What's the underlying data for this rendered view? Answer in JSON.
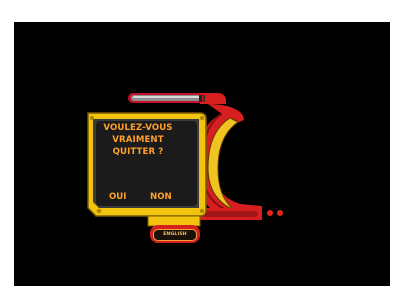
{
  "dialog": {
    "question_lines": [
      "VOULEZ-VOUS",
      "VRAIMENT",
      "QUITTER ?"
    ],
    "yes_label": "OUI",
    "no_label": "NON"
  },
  "language_button": {
    "label": "ENGLISH"
  },
  "colors": {
    "background": "#000000",
    "panel_frame": "#f2c40e",
    "panel_fill": "#1b1b1b",
    "accent_red": "#d82019",
    "text_orange": "#ffa02a"
  },
  "icons": [
    "panel-frame",
    "corner-bolts",
    "indicator-dots",
    "top-rail"
  ]
}
